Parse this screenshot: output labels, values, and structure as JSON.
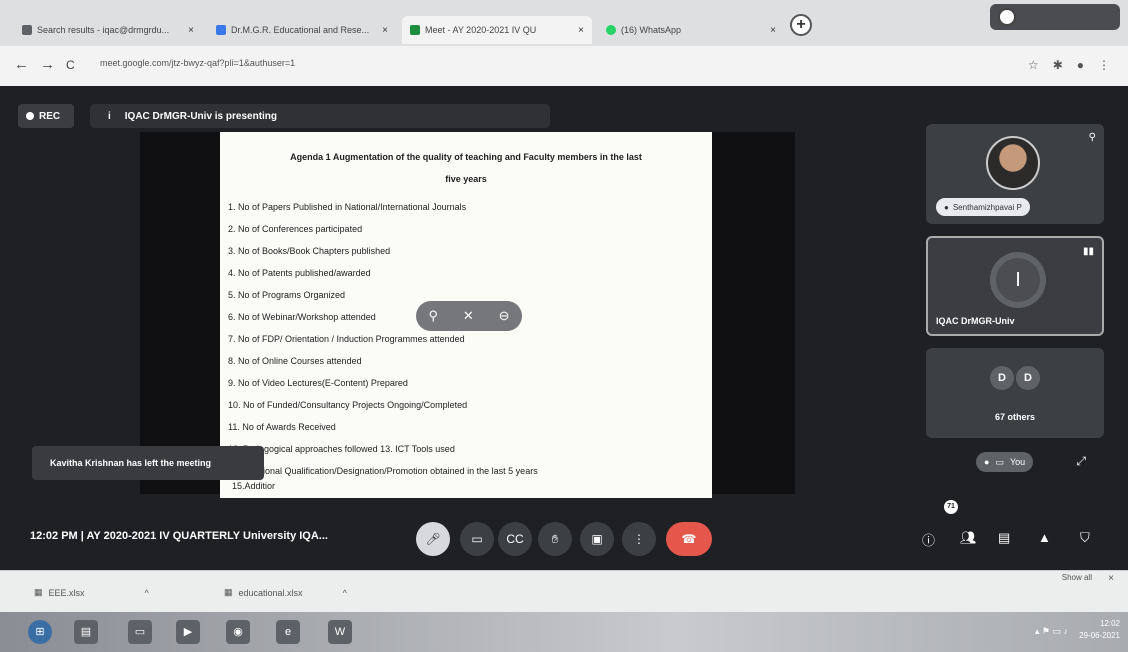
{
  "browser": {
    "tabs": [
      {
        "label": "Search results - iqac@drmgrdu...",
        "close": "×",
        "color": "#5f6368"
      },
      {
        "label": "Dr.M.G.R. Educational and Rese...",
        "close": "×",
        "color": "#3b78e7"
      },
      {
        "label": "Meet - AY 2020-2021 IV QU",
        "close": "×",
        "color": "#1e8e3e"
      },
      {
        "label": "(16) WhatsApp",
        "close": "×",
        "color": "#25d366"
      }
    ],
    "new_tab": "+",
    "url": "meet.google.com/jtz-bwyz-qaf?pli=1&authuser=1",
    "nav": {
      "back": "←",
      "forward": "→",
      "reload": "C"
    }
  },
  "meet": {
    "rec_label": "REC",
    "presenting_text": "IQAC DrMGR-Univ is presenting",
    "slide": {
      "title_line1": "Agenda 1 Augmentation of the quality of teaching and Faculty members in the  last",
      "title_line2": "five years",
      "items": [
        "1.  No of Papers Published in National/International Journals",
        "2.  No of Conferences participated",
        "3.  No of Books/Book Chapters published",
        "4.  No of Patents published/awarded",
        "5.  No of Programs Organized",
        "6.  No of Webinar/Workshop attended",
        "7.  No of FDP/ Orientation / Induction Programmes attended",
        "8.  No of Online Courses attended",
        "9.  No of Video Lectures(E-Content) Prepared",
        "10. No of Funded/Consultancy Projects Ongoing/Completed",
        "11. No of Awards Received",
        "12. Pedagogical approaches followed          13. ICT Tools used",
        "14. Additional Qualification/Designation/Promotion obtained in the last 5 years"
      ],
      "last_item": "15.Additior"
    },
    "toast": "Kavitha Krishnan has left the meeting",
    "participants": {
      "tile1_name": "Senthamizhpavai P",
      "tile2_initial": "I",
      "tile2_name": "IQAC DrMGR-Univ",
      "tile3_initials": [
        "D",
        "D"
      ],
      "tile3_others": "67 others",
      "you_label": "You"
    },
    "bottom": {
      "time_title": "12:02 PM  |  AY 2020-2021 IV QUARTERLY University IQA...",
      "participant_count": "71"
    }
  },
  "downloads": {
    "items": [
      {
        "name": "EEE.xlsx",
        "chevron": "^"
      },
      {
        "name": "educational.xlsx",
        "chevron": "^"
      }
    ],
    "show_all": "Show all",
    "close": "×"
  },
  "taskbar": {
    "clock_time": "12:02",
    "clock_date": "29-06-2021"
  }
}
